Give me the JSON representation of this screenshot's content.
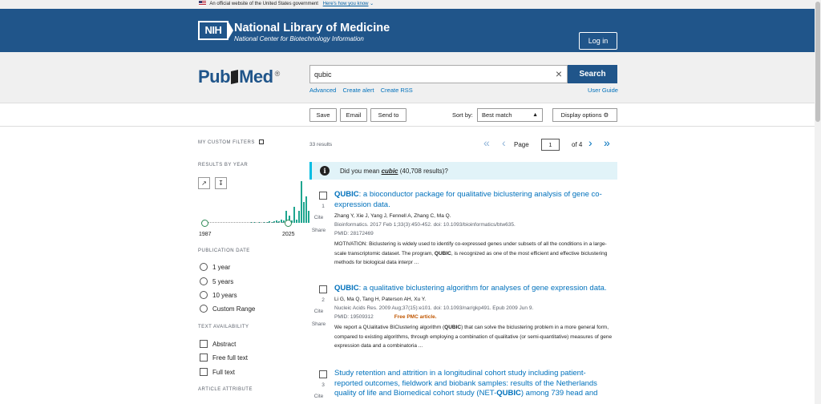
{
  "gov_banner": {
    "text": "An official website of the United States government",
    "link": "Here's how you know"
  },
  "header": {
    "logo": "NIH",
    "title": "National Library of Medicine",
    "subtitle": "National Center for Biotechnology Information",
    "login": "Log in"
  },
  "search": {
    "logo_pub": "Pub",
    "logo_med": "Med",
    "logo_reg": "®",
    "query": "qubic",
    "button": "Search",
    "links": [
      "Advanced",
      "Create alert",
      "Create RSS"
    ],
    "user_guide": "User Guide"
  },
  "toolbar": {
    "save": "Save",
    "email": "Email",
    "send_to": "Send to",
    "sort_label": "Sort by:",
    "sort_value": "Best match",
    "display_options": "Display options"
  },
  "sidebar": {
    "custom_filters": "MY CUSTOM FILTERS",
    "results_by_year": "RESULTS BY YEAR",
    "histogram": [
      1,
      1,
      0,
      1,
      0,
      1,
      1,
      2,
      1,
      2,
      3,
      2,
      4,
      3,
      14,
      8,
      3,
      18,
      4,
      14,
      48,
      24,
      30,
      14
    ],
    "year_start": "1987",
    "year_end": "2025",
    "publication_date": "PUBLICATION DATE",
    "date_options": [
      "1 year",
      "5 years",
      "10 years",
      "Custom Range"
    ],
    "text_availability": "TEXT AVAILABILITY",
    "text_options": [
      "Abstract",
      "Free full text",
      "Full text"
    ],
    "article_attribute": "ARTICLE ATTRIBUTE"
  },
  "results": {
    "count": "33 results",
    "page_label": "Page",
    "page_value": "1",
    "of_pages": "of 4",
    "did_you_mean_prefix": "Did you mean",
    "did_you_mean_term": "cubic",
    "did_you_mean_suffix": "(40,708 results)?"
  },
  "articles": [
    {
      "num": "1",
      "title_hl": "QUBIC",
      "title_rest": ": a bioconductor package for qualitative biclustering analysis of gene co-expression data.",
      "authors": "Zhang Y, Xie J, Yang J, Fennell A, Zhang C, Ma Q.",
      "journal": "Bioinformatics. 2017 Feb 1;33(3):450-452. doi: 10.1093/bioinformatics/btw635.",
      "pmid": "PMID: 28172469",
      "free": "",
      "snip_a": "MOTIVATION: Biclustering is widely used to identify co-expressed genes under subsets of all the conditions in a large-scale transcriptomic dataset. The program, ",
      "snip_hl": "QUBIC",
      "snip_b": ", is recognized as one of the most efficient and effective biclustering methods for biological data interpr ..."
    },
    {
      "num": "2",
      "title_hl": "QUBIC",
      "title_rest": ": a qualitative biclustering algorithm for analyses of gene expression data.",
      "authors": "Li G, Ma Q, Tang H, Paterson AH, Xu Y.",
      "journal": "Nucleic Acids Res. 2009 Aug;37(15):e101. doi: 10.1093/nar/gkp491. Epub 2009 Jun 9.",
      "pmid": "PMID: 19509312",
      "free": "Free PMC article.",
      "snip_a": "We report a QUalitative BIClustering algorithm (",
      "snip_hl": "QUBIC",
      "snip_b": ") that can solve the biclustering problem in a more general form, compared to existing algorithms, through employing a combination of qualitative (or semi-quantitative) measures of gene expression data and a combinatoria ..."
    },
    {
      "num": "3",
      "title_a": "Study retention and attrition in a longitudinal cohort study including patient-reported outcomes, fieldwork and biobank samples: results of the Netherlands quality of life and Biomedical cohort study (NET-",
      "title_hl": "QUBIC",
      "title_b": ") among 739 head and"
    }
  ],
  "common": {
    "cite": "Cite",
    "share": "Share"
  }
}
